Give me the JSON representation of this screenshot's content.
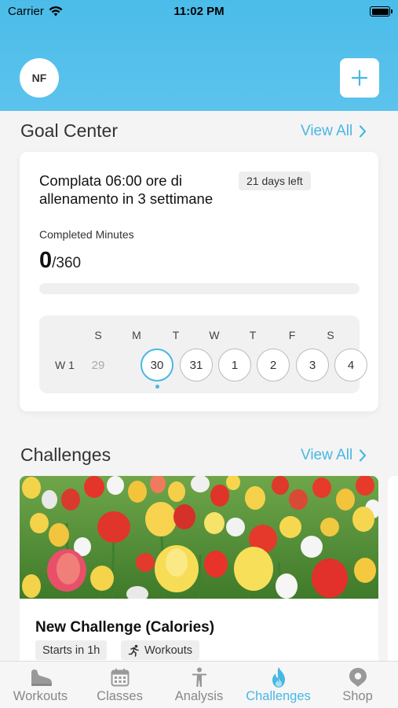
{
  "status_bar": {
    "carrier": "Carrier",
    "time": "11:02 PM"
  },
  "header": {
    "avatar_initials": "NF",
    "add_icon": "plus-icon"
  },
  "goal_center": {
    "title": "Goal Center",
    "view_all": "View All",
    "goal_title": "Complata 06:00 ore di allenamento in 3 settimane",
    "days_left": "21 days left",
    "completed_label": "Completed Minutes",
    "completed_value": "0",
    "completed_total": "/360",
    "progress_fraction": 0,
    "calendar": {
      "week_label": "W 1",
      "day_labels": [
        "S",
        "M",
        "T",
        "W",
        "T",
        "F",
        "S"
      ],
      "dates": [
        "29",
        "30",
        "31",
        "1",
        "2",
        "3",
        "4"
      ],
      "today_index": 1
    }
  },
  "challenges": {
    "title": "Challenges",
    "view_all": "View All",
    "card": {
      "name": "New Challenge (Calories)",
      "start_chip": "Starts in 1h",
      "type_chip": "Workouts",
      "type_icon": "running-person-icon"
    }
  },
  "tab_bar": {
    "items": [
      {
        "label": "Workouts",
        "icon": "shoe-icon",
        "active": false
      },
      {
        "label": "Classes",
        "icon": "calendar-icon",
        "active": false
      },
      {
        "label": "Analysis",
        "icon": "person-icon",
        "active": false
      },
      {
        "label": "Challenges",
        "icon": "flame-icon",
        "active": true
      },
      {
        "label": "Shop",
        "icon": "shop-pin-icon",
        "active": false
      }
    ]
  },
  "colors": {
    "accent": "#48b7e3",
    "header_bg": "#4bbce9"
  }
}
